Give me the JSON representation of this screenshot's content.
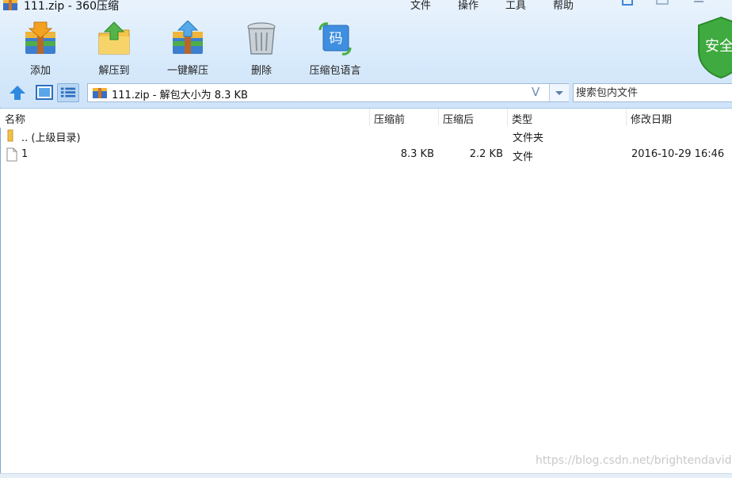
{
  "window": {
    "title": "111.zip - 360压缩"
  },
  "menu": [
    "文件",
    "操作",
    "工具",
    "帮助"
  ],
  "toolbar": [
    {
      "label": "添加",
      "icon": "add-archive-icon"
    },
    {
      "label": "解压到",
      "icon": "extract-to-icon"
    },
    {
      "label": "一键解压",
      "icon": "one-click-extract-icon"
    },
    {
      "label": "删除",
      "icon": "trash-icon"
    },
    {
      "label": "压缩包语言",
      "icon": "encoding-icon",
      "glyph": "码"
    }
  ],
  "security": {
    "label": "安全"
  },
  "address": {
    "value": "111.zip - 解包大小为 8.3 KB",
    "v_glyph": "V"
  },
  "search": {
    "placeholder": "搜索包内文件"
  },
  "columns": {
    "name": "名称",
    "packed_before": "压缩前",
    "packed_after": "压缩后",
    "type": "类型",
    "modified": "修改日期"
  },
  "rows": [
    {
      "name": ".. (上级目录)",
      "before": "",
      "after": "",
      "type": "文件夹",
      "modified": ""
    },
    {
      "name": "1",
      "before": "8.3 KB",
      "after": "2.2 KB",
      "type": "文件",
      "modified": "2016-10-29 16:46"
    }
  ],
  "watermark": "https://blog.csdn.net/brightendavid",
  "colors": {
    "accent": "#3c87d6",
    "header_bg": "#d6e9fb",
    "shield": "#3faa3f"
  }
}
